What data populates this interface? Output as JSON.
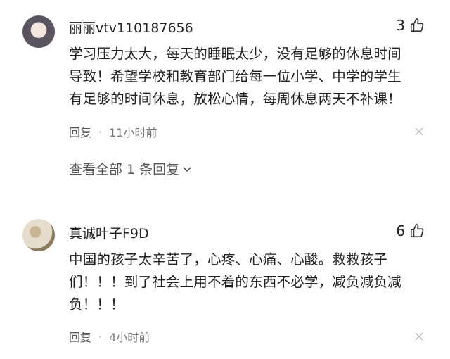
{
  "comments": [
    {
      "username": "丽丽vtv110187656",
      "likes": "3",
      "lines": [
        "学习压力太大，每天的睡眠太少，没有足够的休息时间",
        "导致！希望学校和教育部门给每一位小学、中学的学生",
        "有足够的时间休息，放松心情，每周休息两天不补课！"
      ],
      "reply_label": "回复",
      "separator": "·",
      "time": "11小时前",
      "view_replies": "查看全部 1 条回复"
    },
    {
      "username": "真诚叶子F9D",
      "likes": "6",
      "lines": [
        "中国的孩子太辛苦了，心疼、心痛、心酸。救救孩子",
        "们！！！到了社会上用不着的东西不必学，减负减负减",
        "负！！！"
      ],
      "reply_label": "回复",
      "separator": "·",
      "time": "4小时前"
    }
  ],
  "icons": {
    "thumb": "thumbs-up-icon",
    "close": "close-icon",
    "chevron": "chevron-down-icon"
  },
  "colors": {
    "text": "#222222",
    "meta": "#777777",
    "icon": "#555555"
  }
}
